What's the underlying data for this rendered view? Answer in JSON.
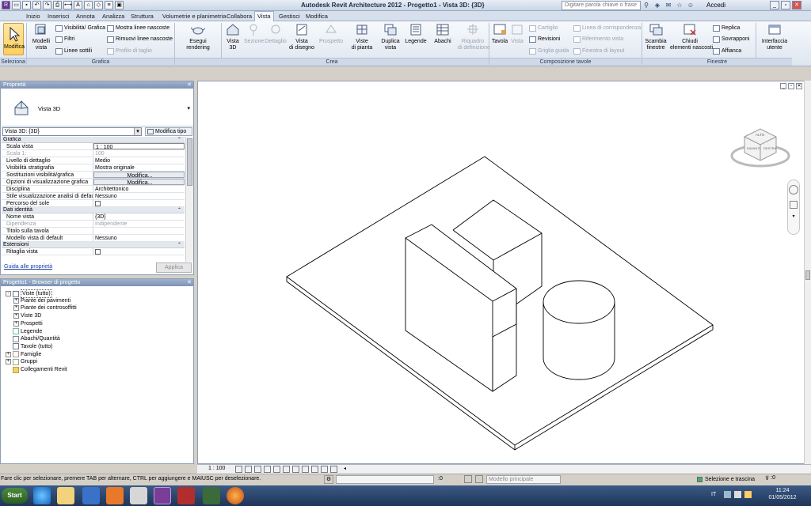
{
  "title_bar": {
    "app_title": "Autodesk Revit Architecture 2012 -    Progetto1 - Vista 3D: {3D}",
    "search_placeholder": "Digitare parola chiave o frase",
    "accedi": "Accedi"
  },
  "tabs": [
    "Inizio",
    "Inserisci",
    "Annota",
    "Analizza",
    "Struttura",
    "Volumetrie e planimetria",
    "Collabora",
    "Vista",
    "Gestisci",
    "Modifica"
  ],
  "active_tab": "Vista",
  "ribbon": {
    "modifica": "Modifica",
    "modelli_vista": "Modelli\nvista",
    "visibilita_grafica": "Visibilità/ Grafica",
    "filtri": "Filtri",
    "linee_sottili": "Linee sottili",
    "mostra_linee_nascoste": "Mostra linee nascoste",
    "rimuovi_linee_nascoste": "Rimuovi linee nascoste",
    "profilo_di_taglio": "Profilo di taglio",
    "esegui_rendering": "Esegui rendering",
    "vista_3d": "Vista\n3D",
    "sezione": "Sezione",
    "dettaglio": "Dettaglio",
    "vista_di_disegno": "Vista\ndi disegno",
    "prospetto": "Prospetto",
    "viste_di_pianta": "Viste\ndi pianta",
    "duplica_vista": "Duplica\nvista",
    "legende": "Legende",
    "abachi": "Abachi",
    "riquadro_di_definizione": "Riquadro\ndi definizione",
    "tavola": "Tavola",
    "vista": "Vista",
    "cartiglio": "Cartiglio",
    "revisioni": "Revisioni",
    "griglia_guida": "Griglia guida",
    "linea_corrispondenza": "Linea di corrispondenza",
    "riferimento_vista": "Riferimento vista",
    "finestra_di_layout": "Finestra di layout",
    "scambia_finestre": "Scambia\nfinestre",
    "chiudi_elementi_nascosti": "Chiudi\nelementi nascosti",
    "replica": "Replica",
    "sovrapponi": "Sovrapponi",
    "affianca": "Affianca",
    "interfaccia_utente": "Interfaccia\nutente",
    "panels": [
      "Seleziona",
      "Grafica",
      "Crea",
      "Composizione tavole",
      "Finestre"
    ]
  },
  "properties": {
    "header": "Proprietà",
    "type_name": "Vista 3D",
    "view_selector": "Vista 3D: {3D}",
    "modifica_tipo": "Modifica tipo",
    "sections": [
      {
        "name": "Grafica",
        "rows": [
          {
            "k": "Scala vista",
            "v": "1 : 100",
            "kind": "input"
          },
          {
            "k": "Scala  1:",
            "v": "100",
            "kind": "dim"
          },
          {
            "k": "Livello di dettaglio",
            "v": "Medio"
          },
          {
            "k": "Visibilità stratigrafia",
            "v": "Mostra originale"
          },
          {
            "k": "Sostituzioni visibilità/grafica",
            "v": "Modifica...",
            "kind": "button"
          },
          {
            "k": "Opzioni di visualizzazione grafica",
            "v": "Modifica...",
            "kind": "button"
          },
          {
            "k": "Disciplina",
            "v": "Architettonico"
          },
          {
            "k": "Stile visualizzazione analisi di default",
            "v": "Nessuno"
          },
          {
            "k": "Percorso del sole",
            "v": "",
            "kind": "check"
          }
        ]
      },
      {
        "name": "Dati identità",
        "rows": [
          {
            "k": "Nome vista",
            "v": "{3D}"
          },
          {
            "k": "Dipendenza",
            "v": "Indipendente",
            "kind": "dim"
          },
          {
            "k": "Titolo sulla tavola",
            "v": ""
          },
          {
            "k": "Modello vista di default",
            "v": "Nessuno"
          }
        ]
      },
      {
        "name": "Estensioni",
        "rows": [
          {
            "k": "Ritaglia vista",
            "v": "",
            "kind": "check"
          }
        ]
      }
    ],
    "help_link": "Guida alle proprietà",
    "apply": "Applica"
  },
  "browser": {
    "header": "Progetto1 - Browser di progetto",
    "nodes": [
      {
        "label": "Viste (tutto)",
        "level": 0,
        "exp": "-"
      },
      {
        "label": "Piante dei pavimenti",
        "level": 1,
        "exp": "+"
      },
      {
        "label": "Piante dei controsoffitti",
        "level": 1,
        "exp": "+"
      },
      {
        "label": "Viste 3D",
        "level": 1,
        "exp": "+"
      },
      {
        "label": "Prospetti",
        "level": 1,
        "exp": "+"
      },
      {
        "label": "Legende",
        "level": 0,
        "exp": ""
      },
      {
        "label": "Abachi/Quantità",
        "level": 0,
        "exp": ""
      },
      {
        "label": "Tavole (tutto)",
        "level": 0,
        "exp": ""
      },
      {
        "label": "Famiglie",
        "level": 0,
        "exp": "+"
      },
      {
        "label": "Gruppi",
        "level": 0,
        "exp": "+"
      },
      {
        "label": "Collegamenti Revit",
        "level": 0,
        "exp": ""
      }
    ]
  },
  "viewport": {
    "scale": "1 : 100",
    "viewcube_top": "ALTO",
    "viewcube_front": "DAVANTI",
    "viewcube_right": "DESTRA"
  },
  "status": {
    "text": "Fare clic per selezionare, premere TAB per alternare, CTRL per aggiungere e MAIUSC per deselezionare.",
    "zero1": ":0",
    "model": "Modello principale",
    "selection": "Selezione e trascina",
    "zero2": ":0"
  },
  "taskbar": {
    "start": "Start",
    "lang": "IT",
    "time": "11:24",
    "date": "01/05/2012"
  }
}
